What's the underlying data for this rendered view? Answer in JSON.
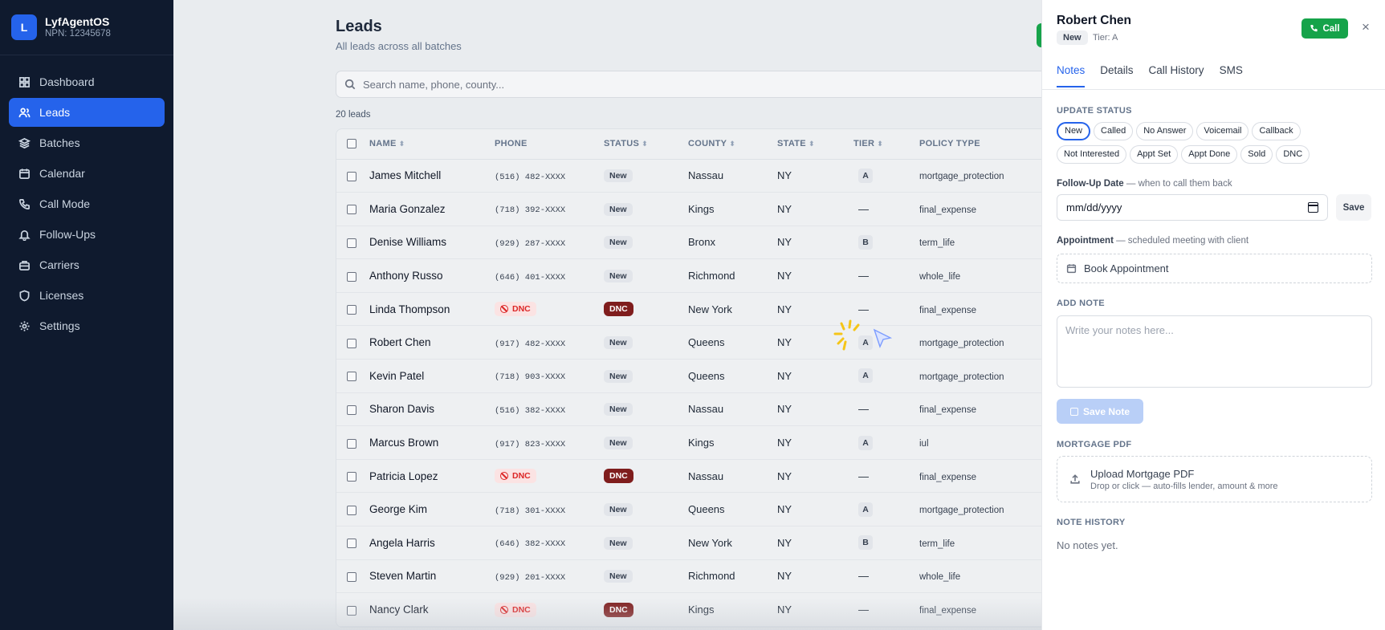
{
  "brand": {
    "logo_letter": "L",
    "title": "LyfAgentOS",
    "subtitle": "NPN: 12345678"
  },
  "sidebar": {
    "items": [
      {
        "label": "Dashboard",
        "icon": "grid-icon"
      },
      {
        "label": "Leads",
        "icon": "users-icon",
        "active": true
      },
      {
        "label": "Batches",
        "icon": "layers-icon"
      },
      {
        "label": "Calendar",
        "icon": "calendar-icon"
      },
      {
        "label": "Call Mode",
        "icon": "phone-icon"
      },
      {
        "label": "Follow-Ups",
        "icon": "bell-icon"
      },
      {
        "label": "Carriers",
        "icon": "briefcase-icon"
      },
      {
        "label": "Licenses",
        "icon": "shield-icon"
      },
      {
        "label": "Settings",
        "icon": "gear-icon"
      }
    ]
  },
  "page": {
    "title": "Leads",
    "subtitle": "All leads across all batches",
    "search_placeholder": "Search name, phone, county...",
    "count": "20 leads"
  },
  "table": {
    "columns": [
      "NAME",
      "PHONE",
      "STATUS",
      "COUNTY",
      "STATE",
      "TIER",
      "POLICY TYPE"
    ],
    "rows": [
      {
        "name": "James Mitchell",
        "phone": "(516) 482-XXXX",
        "status": "New",
        "county": "Nassau",
        "state": "NY",
        "tier": "A",
        "policy": "mortgage_protection"
      },
      {
        "name": "Maria Gonzalez",
        "phone": "(718) 392-XXXX",
        "status": "New",
        "county": "Kings",
        "state": "NY",
        "tier": "—",
        "policy": "final_expense"
      },
      {
        "name": "Denise Williams",
        "phone": "(929) 287-XXXX",
        "status": "New",
        "county": "Bronx",
        "state": "NY",
        "tier": "B",
        "policy": "term_life"
      },
      {
        "name": "Anthony Russo",
        "phone": "(646) 401-XXXX",
        "status": "New",
        "county": "Richmond",
        "state": "NY",
        "tier": "—",
        "policy": "whole_life"
      },
      {
        "name": "Linda Thompson",
        "phone": "DNC",
        "phone_dnc": true,
        "status": "DNC",
        "county": "New York",
        "state": "NY",
        "tier": "—",
        "policy": "final_expense"
      },
      {
        "name": "Robert Chen",
        "phone": "(917) 482-XXXX",
        "status": "New",
        "county": "Queens",
        "state": "NY",
        "tier": "A",
        "policy": "mortgage_protection"
      },
      {
        "name": "Kevin Patel",
        "phone": "(718) 903-XXXX",
        "status": "New",
        "county": "Queens",
        "state": "NY",
        "tier": "A",
        "policy": "mortgage_protection"
      },
      {
        "name": "Sharon Davis",
        "phone": "(516) 382-XXXX",
        "status": "New",
        "county": "Nassau",
        "state": "NY",
        "tier": "—",
        "policy": "final_expense"
      },
      {
        "name": "Marcus Brown",
        "phone": "(917) 823-XXXX",
        "status": "New",
        "county": "Kings",
        "state": "NY",
        "tier": "A",
        "policy": "iul"
      },
      {
        "name": "Patricia Lopez",
        "phone": "DNC",
        "phone_dnc": true,
        "status": "DNC",
        "county": "Nassau",
        "state": "NY",
        "tier": "—",
        "policy": "final_expense"
      },
      {
        "name": "George Kim",
        "phone": "(718) 301-XXXX",
        "status": "New",
        "county": "Queens",
        "state": "NY",
        "tier": "A",
        "policy": "mortgage_protection"
      },
      {
        "name": "Angela Harris",
        "phone": "(646) 382-XXXX",
        "status": "New",
        "county": "New York",
        "state": "NY",
        "tier": "B",
        "policy": "term_life"
      },
      {
        "name": "Steven Martin",
        "phone": "(929) 201-XXXX",
        "status": "New",
        "county": "Richmond",
        "state": "NY",
        "tier": "—",
        "policy": "whole_life"
      },
      {
        "name": "Nancy Clark",
        "phone": "DNC",
        "phone_dnc": true,
        "status": "DNC",
        "county": "Kings",
        "state": "NY",
        "tier": "—",
        "policy": "final_expense"
      }
    ]
  },
  "drawer": {
    "name": "Robert Chen",
    "status": "New",
    "tier": "Tier: A",
    "call_label": "Call",
    "close_glyph": "×",
    "tabs": [
      "Notes",
      "Details",
      "Call History",
      "SMS"
    ],
    "update_status_label": "UPDATE STATUS",
    "status_options": [
      "New",
      "Called",
      "No Answer",
      "Voicemail",
      "Callback",
      "Not Interested",
      "Appt Set",
      "Appt Done",
      "Sold",
      "DNC"
    ],
    "followup_label": "Follow-Up Date",
    "followup_hint": "— when to call them back",
    "date_value": "mm/dd/yyyy",
    "save_label": "Save",
    "appointment_label": "Appointment",
    "appointment_hint": "— scheduled meeting with client",
    "book_label": "Book Appointment",
    "add_note_label": "ADD NOTE",
    "note_placeholder": "Write your notes here...",
    "save_note_label": "Save Note",
    "mortgage_label": "MORTGAGE PDF",
    "upload_title": "Upload Mortgage PDF",
    "upload_sub": "Drop or click — auto-fills lender, amount & more",
    "note_history_label": "NOTE HISTORY",
    "no_notes": "No notes yet."
  },
  "colors": {
    "accent": "#2563eb",
    "call_green": "#16a34a",
    "dnc_red": "#7f1d1d",
    "sidebar_bg": "#0f1a2e"
  }
}
